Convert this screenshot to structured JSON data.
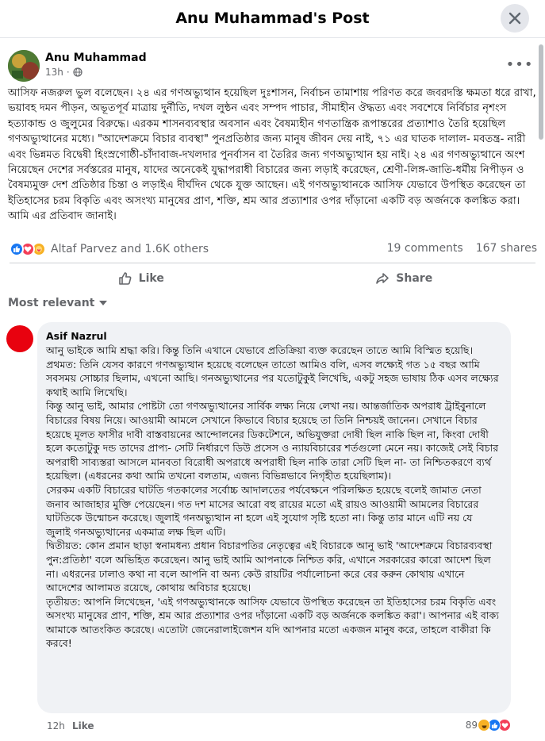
{
  "header": {
    "title": "Anu Muhammad's Post",
    "close_icon": "close-icon"
  },
  "post": {
    "author": "Anu Muhammad",
    "time": "13h",
    "privacy_icon": "globe-icon",
    "more_icon": "more-horizontal-icon",
    "paragraphs": [
      "আসিফ নজরুল ভুল বলেছেন। ২৪ এর গণঅভ্যুত্থান হয়েছিল দুঃশাসন, নির্বাচন তামাশায় পরিণত করে জবরদস্তি ক্ষমতা ধরে রাখা, ভয়াবহ দমন পীড়ন, অভূতপূর্ব মাত্রায় দুর্নীতি, দখল লুন্ঠন এবং সম্পদ পাচার, সীমাহীন ঔদ্ধত্য এবং সবশেষে নির্বিচার নৃশংস হত্যাকান্ড ও জুলুমের বিরুদ্ধে। এরকম শাসনব্যবস্থার অবসান এবং বৈষম্যহীন গণতান্ত্রিক রূপান্তরের প্রত্যাশাও তৈরি হয়েছিল গণঅভ্যুত্থানের মধ্যে। \"আদেশক্রমে বিচার ব্যবস্থা\" পুনপ্রতিষ্ঠার জন্য মানুষ জীবন দেয় নাই, ৭১ এর ঘাতক দালাল- মবতন্ত্র- নারী এবং ভিন্নমত বিদ্বেষী হিংস্রগোষ্ঠী-চাঁদাবাজ-দখলদার পুনর্বাসন বা তৈরির জন্য গণঅভ্যুত্থান হয় নাই। ২৪ এর গণঅভ্যুত্থানে অংশ নিয়েছেন দেশের সর্বস্তরের মানুষ, যাদের অনেকেই যুদ্ধাপরাধী বিচারের জন্য লড়াই করেছেন, শ্রেণী-লিঙ্গ-জাতি-ধর্মীয় নিপীড়ন ও বৈষম্যমুক্ত দেশ প্রতিষ্ঠার চিন্তা ও লড়াইএ দীর্ঘদিন থেকে যুক্ত আছেন। এই গণঅভ্যুত্থানকে আসিফ যেভাবে উপস্থিত করেছেন তা ইতিহাসের চরম বিকৃতি এবং অসংখ্য মানুষের প্রাণ, শক্তি, শ্রম আর প্রত্যাশার ওপর দাঁড়ানো একটি বড় অর্জনকে কলঙ্কিত করা। আমি এর প্রতিবাদ জানাই।"
    ]
  },
  "stats": {
    "reactions_text": "Altaf Parvez and 1.6K others",
    "comments": "19 comments",
    "shares": "167 shares",
    "like_color": "#1877f2",
    "love_color": "#f33e58",
    "care_color": "#f7b125"
  },
  "actions": {
    "like": "Like",
    "share": "Share"
  },
  "sort": {
    "label": "Most relevant"
  },
  "comment": {
    "author": "Asif Nazrul",
    "avatar_color": "#e8020f",
    "paragraphs": [
      "আনু ভাইকে আমি শ্রদ্ধা করি। কিন্তু তিনি এখানে যেভাবে প্রতিক্রিয়া ব্যক্ত করেছেন তাতে আমি বিস্মিত হয়েছি।",
      "প্রথমত: তিনি যেসব কারণে গণঅভ্যুত্থান হয়েছে বলেছেন তাতো আমিও বলি, এসব লক্ষ্যেই গত ১৫ বছর আমি সবসময় সোচ্চার ছিলাম, এখনো আছি। গনঅভ্যুত্থানের পর যতোটুকুই লিখেছি, একটু সহজ ভাষায় ঠিক এসব লক্ষ্যের কথাই আমি লিখেছি।",
      "কিন্তু আনু ভাই, আমার পোষ্টটা তো গণঅভ্যুত্থানের সার্বিক লক্ষ্য নিয়ে লেখা নয়। আন্তর্জাতিক অপরাধ ট্রাইবুনালে বিচারের বিষয় নিয়ে। আওয়ামী আমলে সেখানে কিভাবে বিচার হয়েছে তা তিনি নিশ্চয়ই জানেন। সেখানে বিচার হয়েছে মূলত ফাসীর দাবী বাস্তবায়নের আন্দোলনের ডিকটেশনে, অভিযুক্তরা দোষী ছিল নাকি ছিল না, কিংবা দোষী হলে কতোটুকু দন্ড তাদের প্রাপ্য- সেটি নির্ধারণে ডিউ প্রসেস ও ন্যায়বিচারের শর্তগুলো মেনে নয়। কাজেই সেই বিচার অপরাধী সাব্যস্তরা আসলে মানবতা বিরোধী অপরাধে অপরাধী ছিল নাকি তারা সেটি ছিল না- তা নিশ্চিতকরণে ব্যর্থ হয়েছিল। (এধরনের কথা আমি তখনো বলতাম, এজন্য বিভিন্নভাবে নিগৃহীত হয়েছিলাম)।",
      "সেরকম একটি বিচারের ঘাটতি গতকালের সর্বোচ্চ আদালতের পর্যবেক্ষনে পরিলক্ষিত হয়েছে বলেই জামাত নেতা জনাব আজাহার মুক্তি পেয়েছেন। গত দশ মাসের আরো বহু রায়ের মতো এই রায়ও আওয়ামী আমলের বিচারের ঘাটতিকে উন্মোচন করেছে। জুলাই গনঅভ্যুত্থান না হলে এই সুযোগ সৃষ্টি হতো না। কিন্তু তার মানে এটি নয় যে জুলাই গনঅভ্যুত্থানের একমাত্র লক্ষ ছিল এটি।",
      "দ্বিতীয়ত: কোন প্রমান ছাড়া স্বনামধন্য প্রধান বিচারপতির নেতৃত্বের এই বিচারকে আনু ভাই 'আদেশক্রমে বিচারব্যবস্থা পুন:প্রতিষ্ঠা' বলে অভিহিত করেছেন। আনু ভাই আমি আপনাকে নিশ্চিত করি, এখানে সরকারের কারো আদেশ ছিল না। এধরনের ঢালাও কথা না বলে আপনি বা অন্য কেউ রায়টির পর্যালোচনা করে বের করুন কোথায় এখানে আদেশের আলামত রয়েছে, কোথায় অবিচার হয়েছে।",
      "তৃতীয়ত: আপনি লিখেছেন, 'এই গণঅভ্যুত্থানকে আসিফ যেভাবে উপস্থিত করেছেন তা ইতিহাসের চরম বিকৃতি এবং অসংখ্য মানুষের প্রাণ, শক্তি, শ্রম আর প্রত্যাশার ওপর দাঁড়ানো একটি বড় অর্জনকে কলঙ্কিত করা'। আপনার এই বাক্য আমাকে আতংকিত করেছে। এতোটা জেনেরালাইজেশন যদি আপনার মতো একজন মানুষ করে, তাহলে বাকীরা কি করবে!"
    ],
    "time": "12h",
    "like_label": "Like",
    "reaction_count": "89"
  }
}
